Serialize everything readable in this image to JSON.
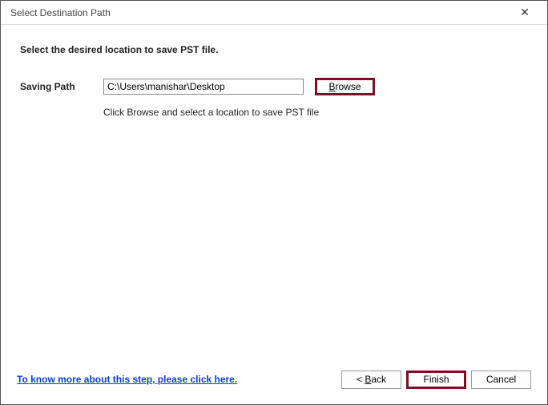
{
  "titlebar": {
    "title": "Select Destination Path",
    "close_glyph": "✕"
  },
  "main": {
    "instruction": "Select the desired location to save PST file.",
    "path_label": "Saving Path",
    "path_value": "C:\\Users\\manishar\\Desktop",
    "browse_prefix": "B",
    "browse_rest": "rowse",
    "hint": "Click Browse and select a location to save PST file"
  },
  "footer": {
    "help_link": "To know more about this step, please click here.",
    "back_prefix": "< ",
    "back_u": "B",
    "back_rest": "ack",
    "finish_label": "Finish",
    "cancel_label": "Cancel"
  }
}
